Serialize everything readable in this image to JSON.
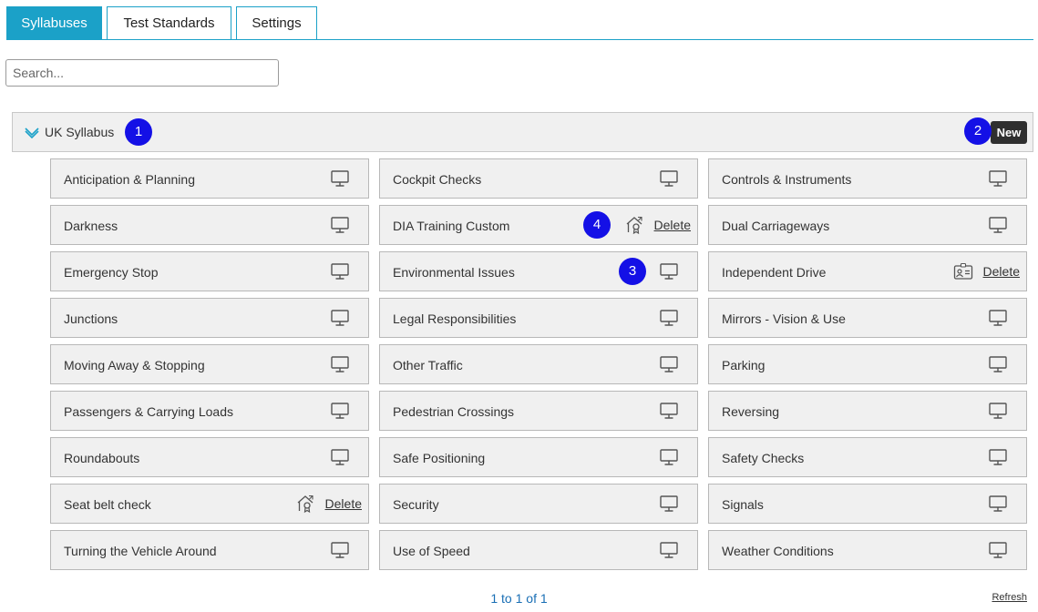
{
  "tabs": [
    "Syllabuses",
    "Test Standards",
    "Settings"
  ],
  "search": {
    "placeholder": "Search..."
  },
  "group": {
    "title": "UK Syllabus",
    "new_label": "New"
  },
  "markers": [
    "1",
    "2",
    "3",
    "4"
  ],
  "items": [
    {
      "label": "Anticipation & Planning",
      "icon": "monitor-icon",
      "deletable": false
    },
    {
      "label": "Cockpit Checks",
      "icon": "monitor-icon",
      "deletable": false
    },
    {
      "label": "Controls & Instruments",
      "icon": "monitor-icon",
      "deletable": false
    },
    {
      "label": "Darkness",
      "icon": "monitor-icon",
      "deletable": false
    },
    {
      "label": "DIA Training Custom",
      "icon": "lesson-icon",
      "deletable": true
    },
    {
      "label": "Dual Carriageways",
      "icon": "monitor-icon",
      "deletable": false
    },
    {
      "label": "Emergency Stop",
      "icon": "monitor-icon",
      "deletable": false
    },
    {
      "label": "Environmental Issues",
      "icon": "monitor-icon",
      "deletable": false
    },
    {
      "label": "Independent Drive",
      "icon": "id-card-icon",
      "deletable": true
    },
    {
      "label": "Junctions",
      "icon": "monitor-icon",
      "deletable": false
    },
    {
      "label": "Legal Responsibilities",
      "icon": "monitor-icon",
      "deletable": false
    },
    {
      "label": "Mirrors - Vision & Use",
      "icon": "monitor-icon",
      "deletable": false
    },
    {
      "label": "Moving Away & Stopping",
      "icon": "monitor-icon",
      "deletable": false
    },
    {
      "label": "Other Traffic",
      "icon": "monitor-icon",
      "deletable": false
    },
    {
      "label": "Parking",
      "icon": "monitor-icon",
      "deletable": false
    },
    {
      "label": "Passengers & Carrying Loads",
      "icon": "monitor-icon",
      "deletable": false
    },
    {
      "label": "Pedestrian Crossings",
      "icon": "monitor-icon",
      "deletable": false
    },
    {
      "label": "Reversing",
      "icon": "monitor-icon",
      "deletable": false
    },
    {
      "label": "Roundabouts",
      "icon": "monitor-icon",
      "deletable": false
    },
    {
      "label": "Safe Positioning",
      "icon": "monitor-icon",
      "deletable": false
    },
    {
      "label": "Safety Checks",
      "icon": "monitor-icon",
      "deletable": false
    },
    {
      "label": "Seat belt check",
      "icon": "lesson-icon",
      "deletable": true
    },
    {
      "label": "Security",
      "icon": "monitor-icon",
      "deletable": false
    },
    {
      "label": "Signals",
      "icon": "monitor-icon",
      "deletable": false
    },
    {
      "label": "Turning the Vehicle Around",
      "icon": "monitor-icon",
      "deletable": false
    },
    {
      "label": "Use of Speed",
      "icon": "monitor-icon",
      "deletable": false
    },
    {
      "label": "Weather Conditions",
      "icon": "monitor-icon",
      "deletable": false
    }
  ],
  "delete_label": "Delete",
  "pagination": {
    "text": "1 to 1 of 1"
  },
  "refresh_label": "Refresh",
  "colors": {
    "accent": "#1ba1c8",
    "marker": "#1410e6",
    "card_bg": "#f0f0f0",
    "pager_text": "#1a6fb5"
  }
}
